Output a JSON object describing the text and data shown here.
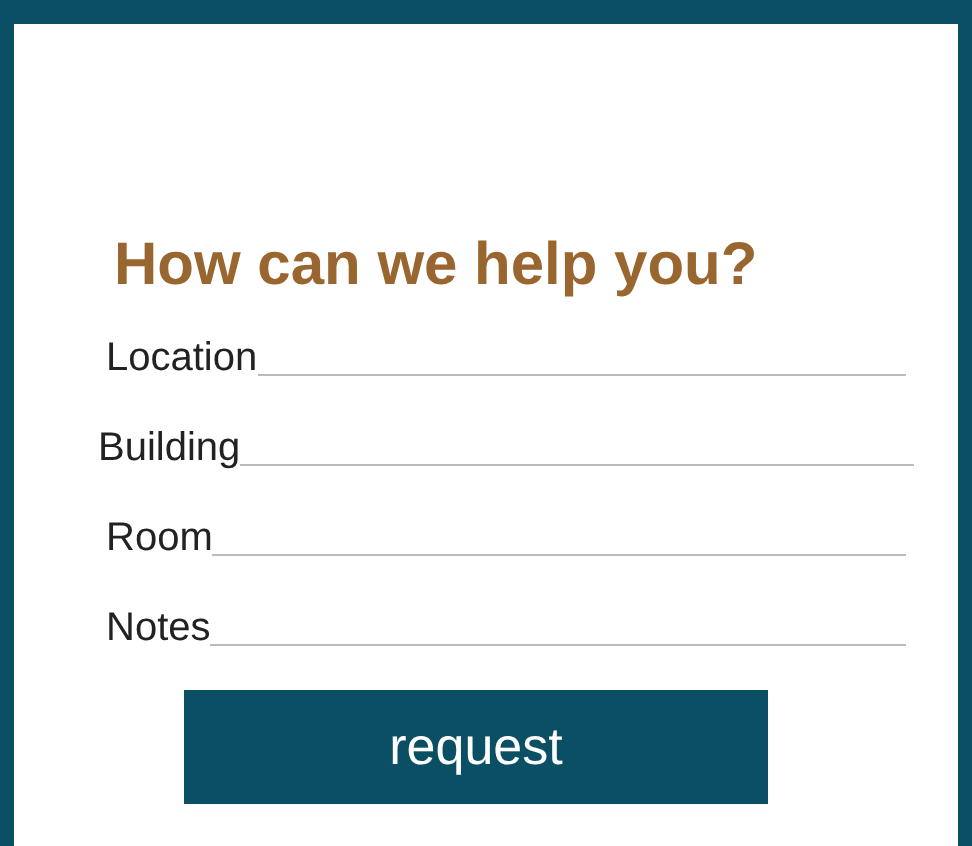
{
  "heading": "How can we help you?",
  "fields": [
    {
      "label": "Location"
    },
    {
      "label": "Building"
    },
    {
      "label": "Room"
    },
    {
      "label": "Notes"
    }
  ],
  "button": "request"
}
